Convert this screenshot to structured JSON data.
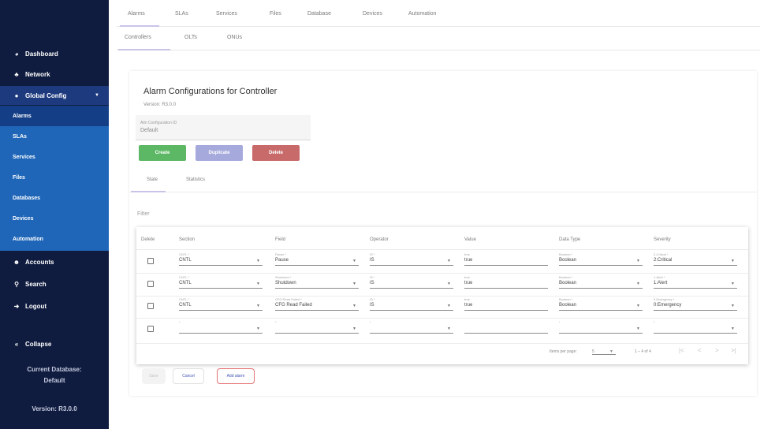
{
  "sidebar": {
    "dashboard": "Dashboard",
    "network": "Network",
    "global_config": "Global Config",
    "sub_items": [
      "Alarms",
      "SLAs",
      "Services",
      "Files",
      "Databases",
      "Devices",
      "Automation"
    ],
    "accounts": "Accounts",
    "search": "Search",
    "logout": "Logout",
    "collapse": "Collapse",
    "current_db_label": "Current Database:",
    "current_db_value": "Default",
    "version": "Version: R3.0.0"
  },
  "top_tabs": [
    "Alarms",
    "SLAs",
    "Services",
    "Files",
    "Database",
    "Devices",
    "Automation"
  ],
  "sub_tabs": [
    "Controllers",
    "OLTs",
    "ONUs"
  ],
  "card": {
    "title": "Alarm Configurations for Controller",
    "version": "Version: R3.0.0",
    "config_id_label": "Alm Configuration ID",
    "config_id_value": "Default",
    "create": "Create",
    "duplicate": "Duplicate",
    "delete": "Delete",
    "inner_tabs": [
      "State",
      "Statistics"
    ],
    "filter": "Filter"
  },
  "table": {
    "headers": [
      "Delete",
      "Section",
      "Field",
      "Operator",
      "Value",
      "Data Type",
      "Severity"
    ],
    "rows": [
      {
        "section_label": "CNTL *",
        "section": "CNTL",
        "field_label": "Pause *",
        "field": "Pause",
        "operator_label": "IS *",
        "operator": "IS",
        "value_label": "true",
        "value": "true",
        "datatype_label": "Boolean *",
        "datatype": "Boolean",
        "severity_label": "2-Critical *",
        "severity": "2:Critical"
      },
      {
        "section_label": "CNTL *",
        "section": "CNTL",
        "field_label": "Shutdown *",
        "field": "Shutdown",
        "operator_label": "IS *",
        "operator": "IS",
        "value_label": "true",
        "value": "true",
        "datatype_label": "Boolean *",
        "datatype": "Boolean",
        "severity_label": "1-Alert *",
        "severity": "1:Alert"
      },
      {
        "section_label": "CNTL *",
        "section": "CNTL",
        "field_label": "CFG Read Failed *",
        "field": "CFG Read Failed",
        "operator_label": "IS *",
        "operator": "IS",
        "value_label": "true",
        "value": "true",
        "datatype_label": "Boolean *",
        "datatype": "Boolean",
        "severity_label": "0-Emergency *",
        "severity": "0:Emergency"
      },
      {
        "section_label": "*",
        "section": "",
        "field_label": "*",
        "field": "",
        "operator_label": "*",
        "operator": "",
        "value_label": "",
        "value": "",
        "datatype_label": "*",
        "datatype": "",
        "severity_label": "*",
        "severity": ""
      }
    ],
    "pagination": {
      "items_per_page_label": "Items per page:",
      "items_per_page": "5",
      "range": "1 – 4 of 4"
    }
  },
  "bottom": {
    "save": "Save",
    "cancel": "Cancel",
    "add_alarm": "Add alarm"
  },
  "colors": {
    "sidebar_bg": "#0f1c3f",
    "sidebar_group": "#1d3a7e",
    "sidebar_sub": "#1f66b8",
    "create": "#5cb865",
    "duplicate": "#a6a9dc",
    "delete": "#c86a6a"
  }
}
